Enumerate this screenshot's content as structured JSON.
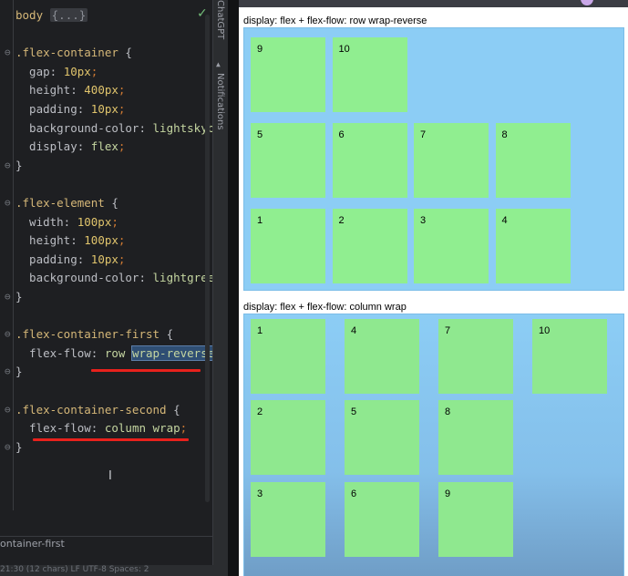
{
  "editor": {
    "lines": [
      {
        "fold": "",
        "parts": [
          {
            "c": "sel",
            "t": "body "
          },
          {
            "c": "folded",
            "t": "{...}"
          }
        ]
      },
      {
        "fold": "",
        "parts": []
      },
      {
        "fold": "⊖",
        "parts": [
          {
            "c": "sel",
            "t": ".flex-container "
          },
          {
            "c": "punct",
            "t": "{"
          }
        ]
      },
      {
        "fold": "",
        "parts": [
          {
            "c": "prop",
            "t": "  gap: "
          },
          {
            "c": "num",
            "t": "10px"
          },
          {
            "c": "semi",
            "t": ";"
          }
        ]
      },
      {
        "fold": "",
        "parts": [
          {
            "c": "prop",
            "t": "  height: "
          },
          {
            "c": "num",
            "t": "400px"
          },
          {
            "c": "semi",
            "t": ";"
          }
        ]
      },
      {
        "fold": "",
        "parts": [
          {
            "c": "prop",
            "t": "  padding: "
          },
          {
            "c": "num",
            "t": "10px"
          },
          {
            "c": "semi",
            "t": ";"
          }
        ]
      },
      {
        "fold": "",
        "parts": [
          {
            "c": "prop",
            "t": "  background-color: "
          },
          {
            "c": "val",
            "t": "lightskyblue"
          }
        ]
      },
      {
        "fold": "",
        "parts": [
          {
            "c": "prop",
            "t": "  display: "
          },
          {
            "c": "val",
            "t": "flex"
          },
          {
            "c": "semi",
            "t": ";"
          }
        ]
      },
      {
        "fold": "⊖",
        "parts": [
          {
            "c": "punct",
            "t": "}"
          }
        ]
      },
      {
        "fold": "",
        "parts": []
      },
      {
        "fold": "⊖",
        "parts": [
          {
            "c": "sel",
            "t": ".flex-element "
          },
          {
            "c": "punct",
            "t": "{"
          }
        ]
      },
      {
        "fold": "",
        "parts": [
          {
            "c": "prop",
            "t": "  width: "
          },
          {
            "c": "num",
            "t": "100px"
          },
          {
            "c": "semi",
            "t": ";"
          }
        ]
      },
      {
        "fold": "",
        "parts": [
          {
            "c": "prop",
            "t": "  height: "
          },
          {
            "c": "num",
            "t": "100px"
          },
          {
            "c": "semi",
            "t": ";"
          }
        ]
      },
      {
        "fold": "",
        "parts": [
          {
            "c": "prop",
            "t": "  padding: "
          },
          {
            "c": "num",
            "t": "10px"
          },
          {
            "c": "semi",
            "t": ";"
          }
        ]
      },
      {
        "fold": "",
        "parts": [
          {
            "c": "prop",
            "t": "  background-color: "
          },
          {
            "c": "val",
            "t": "lightgreen"
          },
          {
            "c": "semi",
            "t": ";"
          }
        ]
      },
      {
        "fold": "⊖",
        "parts": [
          {
            "c": "punct",
            "t": "}"
          }
        ]
      },
      {
        "fold": "",
        "parts": []
      },
      {
        "fold": "⊖",
        "parts": [
          {
            "c": "sel",
            "t": ".flex-container-first "
          },
          {
            "c": "punct",
            "t": "{"
          }
        ]
      },
      {
        "fold": "",
        "parts": [
          {
            "c": "prop",
            "t": "  flex-flow: "
          },
          {
            "c": "val",
            "t": "row "
          },
          {
            "c": "val hl",
            "t": "wrap-reverse"
          },
          {
            "c": "semi",
            "t": ";"
          }
        ]
      },
      {
        "fold": "⊖",
        "parts": [
          {
            "c": "punct",
            "t": "}"
          }
        ]
      },
      {
        "fold": "",
        "parts": []
      },
      {
        "fold": "⊖",
        "parts": [
          {
            "c": "sel",
            "t": ".flex-container-second "
          },
          {
            "c": "punct",
            "t": "{"
          }
        ]
      },
      {
        "fold": "",
        "parts": [
          {
            "c": "prop",
            "t": "  flex-flow: "
          },
          {
            "c": "val",
            "t": "column wrap"
          },
          {
            "c": "semi",
            "t": ";"
          }
        ]
      },
      {
        "fold": "⊖",
        "parts": [
          {
            "c": "punct",
            "t": "}"
          }
        ]
      }
    ],
    "breadcrumb": "ontainer-first",
    "status": "21:30  (12 chars)  LF  UTF-8  Spaces: 2"
  },
  "toolstrip": {
    "chatgpt": "ChatGPT",
    "notifications": "Notifications"
  },
  "preview": {
    "demo1": {
      "label": "display: flex + flex-flow: row wrap-reverse",
      "items": [
        "9",
        "10",
        "5",
        "6",
        "7",
        "8",
        "1",
        "2",
        "3",
        "4"
      ]
    },
    "demo2": {
      "label": "display: flex + flex-flow: column wrap",
      "items": [
        "1",
        "4",
        "7",
        "10",
        "2",
        "5",
        "8",
        "3",
        "6",
        "9"
      ]
    }
  }
}
